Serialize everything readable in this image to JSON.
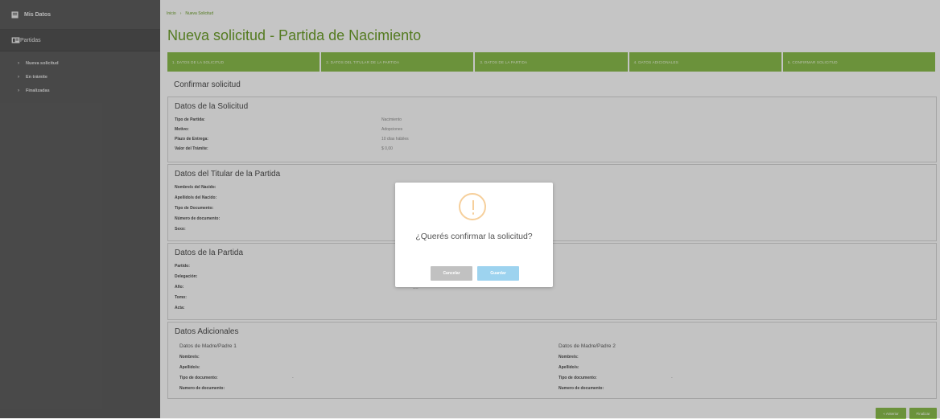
{
  "sidebar": {
    "header": "Mis Datos",
    "section": "Partidas",
    "items": [
      {
        "label": "Nueva solicitud"
      },
      {
        "label": "En trámite"
      },
      {
        "label": "Finalizadas"
      }
    ]
  },
  "breadcrumb": {
    "home": "Inicio",
    "current": "Nueva Solicitud"
  },
  "page_title": "Nueva solicitud - Partida de Nacimiento",
  "steps": [
    "1. Datos de la solicitud",
    "2. Datos del titular de la partida",
    "3. Datos de la partida",
    "4. Datos adicionales",
    "5. Confirmar solicitud"
  ],
  "confirm_title": "Confirmar solicitud",
  "solicitud": {
    "title": "Datos de la Solicitud",
    "rows": [
      {
        "label": "Tipo de Partida:",
        "value": "Nacimiento"
      },
      {
        "label": "Motivo:",
        "value": "Adopciones"
      },
      {
        "label": "Plazo de Entrega:",
        "value": "10 días hábiles"
      },
      {
        "label": "Valor del Trámite:",
        "value": "$ 0,00"
      }
    ]
  },
  "titular": {
    "title": "Datos del Titular de la Partida",
    "rows": [
      {
        "label": "Nombre/s del Nacido:"
      },
      {
        "label": "Apellido/s del Nacido:"
      },
      {
        "label": "Tipo de Documento:"
      },
      {
        "label": "Número de documento:"
      },
      {
        "label": "Sexo:"
      }
    ]
  },
  "partida": {
    "title": "Datos de la Partida",
    "rows": [
      {
        "label": "Partido:"
      },
      {
        "label": "Delegación:"
      },
      {
        "label": "Año:",
        "value": "----"
      },
      {
        "label": "Tomo:"
      },
      {
        "label": "Acta:"
      }
    ]
  },
  "adicionales": {
    "title": "Datos Adicionales",
    "col1": {
      "title": "Datos de Madre/Padre 1",
      "rows": [
        "Nombre/s:",
        "Apellido/s:",
        "Tipo de documento:",
        "Numero de documento:"
      ],
      "dash": "-"
    },
    "col2": {
      "title": "Datos de Madre/Padre 2",
      "rows": [
        "Nombre/s:",
        "Apellido/s:",
        "Tipo de documento:",
        "Numero de documento:"
      ],
      "dash": "-"
    }
  },
  "footer": {
    "anterior": "« Anterior",
    "finalizar": "Finalizar"
  },
  "modal": {
    "question": "¿Querés confirmar la solicitud?",
    "cancel": "Cancelar",
    "save": "Guardar",
    "colors": {
      "warn": "#f6cf9b",
      "cancel": "#c1c1c1",
      "save": "#9dd3ef"
    }
  },
  "colors": {
    "accent": "#86b74a",
    "sidebar": "#5b5b5b"
  }
}
